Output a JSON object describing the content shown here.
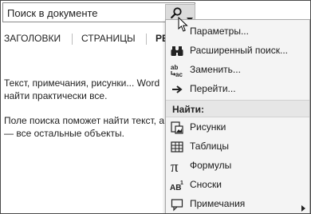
{
  "search": {
    "value": "Поиск в документе"
  },
  "tabs": [
    {
      "label": "ЗАГОЛОВКИ"
    },
    {
      "label": "СТРАНИЦЫ"
    },
    {
      "label": "РЕ"
    }
  ],
  "document": {
    "paragraph1": [
      "Текст, примечания, рисунки... Word",
      "найти практически все."
    ],
    "paragraph2": [
      "Поле поиска поможет найти текст, а",
      "— все остальные объекты."
    ]
  },
  "menu": {
    "items_top": [
      {
        "label": "Параметры...",
        "icon": "none"
      },
      {
        "label": "Расширенный поиск...",
        "icon": "binoculars-icon"
      },
      {
        "label": "Заменить...",
        "icon": "replace-icon"
      },
      {
        "label": "Перейти...",
        "icon": "arrow-right-icon"
      }
    ],
    "section_header": "Найти:",
    "items_find": [
      {
        "label": "Рисунки",
        "icon": "image-icon"
      },
      {
        "label": "Таблицы",
        "icon": "table-icon"
      },
      {
        "label": "Формулы",
        "icon": "pi-icon"
      },
      {
        "label": "Сноски",
        "icon": "footnote-icon"
      },
      {
        "label": "Примечания",
        "icon": "comment-icon",
        "has_submenu": true
      }
    ]
  }
}
